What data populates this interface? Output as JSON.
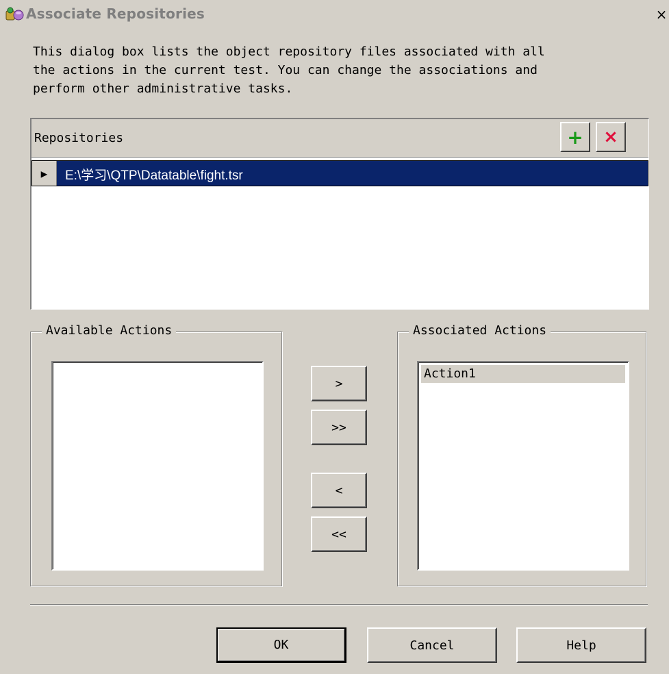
{
  "window": {
    "title": "Associate Repositories",
    "close_glyph": "×",
    "icon": "qtp-app-icon"
  },
  "description": "This dialog box lists the object repository files associated with all\nthe actions in the current test. You can change the associations and\nperform other administrative tasks.",
  "repositories": {
    "header_label": "Repositories",
    "add_glyph": "+",
    "delete_glyph": "×",
    "row_selector_glyph": "▶",
    "rows": [
      {
        "path": "E:\\学习\\QTP\\Datatable\\fight.tsr"
      }
    ]
  },
  "available_actions": {
    "label": "Available Actions",
    "items": []
  },
  "associated_actions": {
    "label": "Associated Actions",
    "items": [
      "Action1"
    ]
  },
  "move_buttons": {
    "move_one": ">",
    "move_all": ">>",
    "remove_one": "<",
    "remove_all": "<<"
  },
  "footer": {
    "ok": "OK",
    "cancel": "Cancel",
    "help": "Help"
  },
  "colors": {
    "dialog_bg": "#d4d0c8",
    "selection_bg": "#0a246a",
    "add_icon": "#1a9a1a",
    "delete_icon": "#e0103c",
    "title_text": "#7f7f7f"
  }
}
